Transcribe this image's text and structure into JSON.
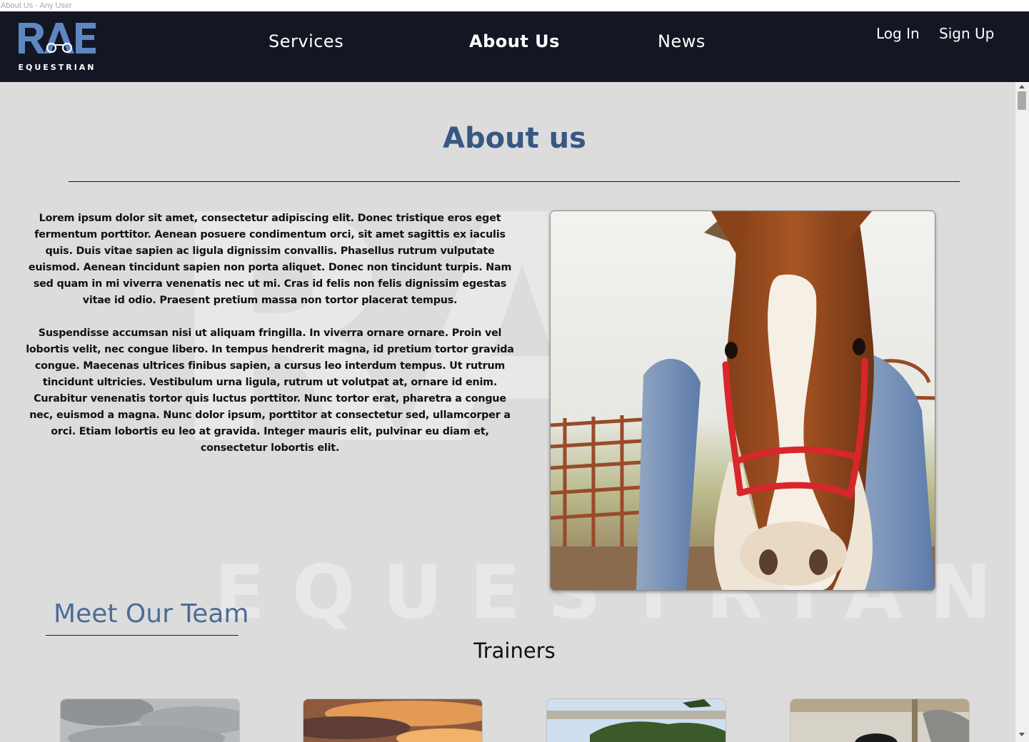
{
  "window": {
    "title": "About Us - Any User"
  },
  "logo": {
    "mark_text": "RAE",
    "subtitle": "EQUESTRIAN"
  },
  "nav": {
    "items": [
      {
        "label": "Services"
      },
      {
        "label": "About Us"
      },
      {
        "label": "News"
      }
    ],
    "auth": {
      "login": "Log In",
      "signup": "Sign Up"
    }
  },
  "page": {
    "title": "About us",
    "paragraph1": "Lorem ipsum dolor sit amet, consectetur adipiscing elit. Donec tristique eros eget fermentum porttitor. Aenean posuere condimentum orci, sit amet sagittis ex iaculis quis. Duis vitae sapien ac ligula dignissim convallis. Phasellus rutrum vulputate euismod. Aenean tincidunt sapien non porta aliquet. Donec non tincidunt turpis. Nam sed quam in mi viverra venenatis nec ut mi. Cras id felis non felis dignissim egestas vitae id odio. Praesent pretium massa non tortor placerat tempus.",
    "paragraph2": "Suspendisse accumsan nisi ut aliquam fringilla. In viverra ornare ornare. Proin vel lobortis velit, nec congue libero. In tempus hendrerit magna, id pretium tortor gravida congue. Maecenas ultrices finibus sapien, a cursus leo interdum tempus. Ut rutrum tincidunt ultricies. Vestibulum urna ligula, rutrum ut volutpat at, ornare id enim. Curabitur venenatis tortor quis luctus porttitor. Nunc tortor erat, pharetra a congue nec, euismod a magna. Nunc dolor ipsum, porttitor at consectetur sed, ullamcorper a orci. Etiam lobortis eu leo at gravida. Integer mauris elit, pulvinar eu diam et, consectetur lobortis elit.",
    "watermark_letters": "RAE",
    "watermark_word": "EQUESTRIAN"
  },
  "team": {
    "title": "Meet Our Team",
    "subtitle": "Trainers"
  },
  "colors": {
    "navbar": "#131723",
    "accent": "#385783",
    "team_title": "#4b6d96",
    "background": "#dcdcdc"
  }
}
